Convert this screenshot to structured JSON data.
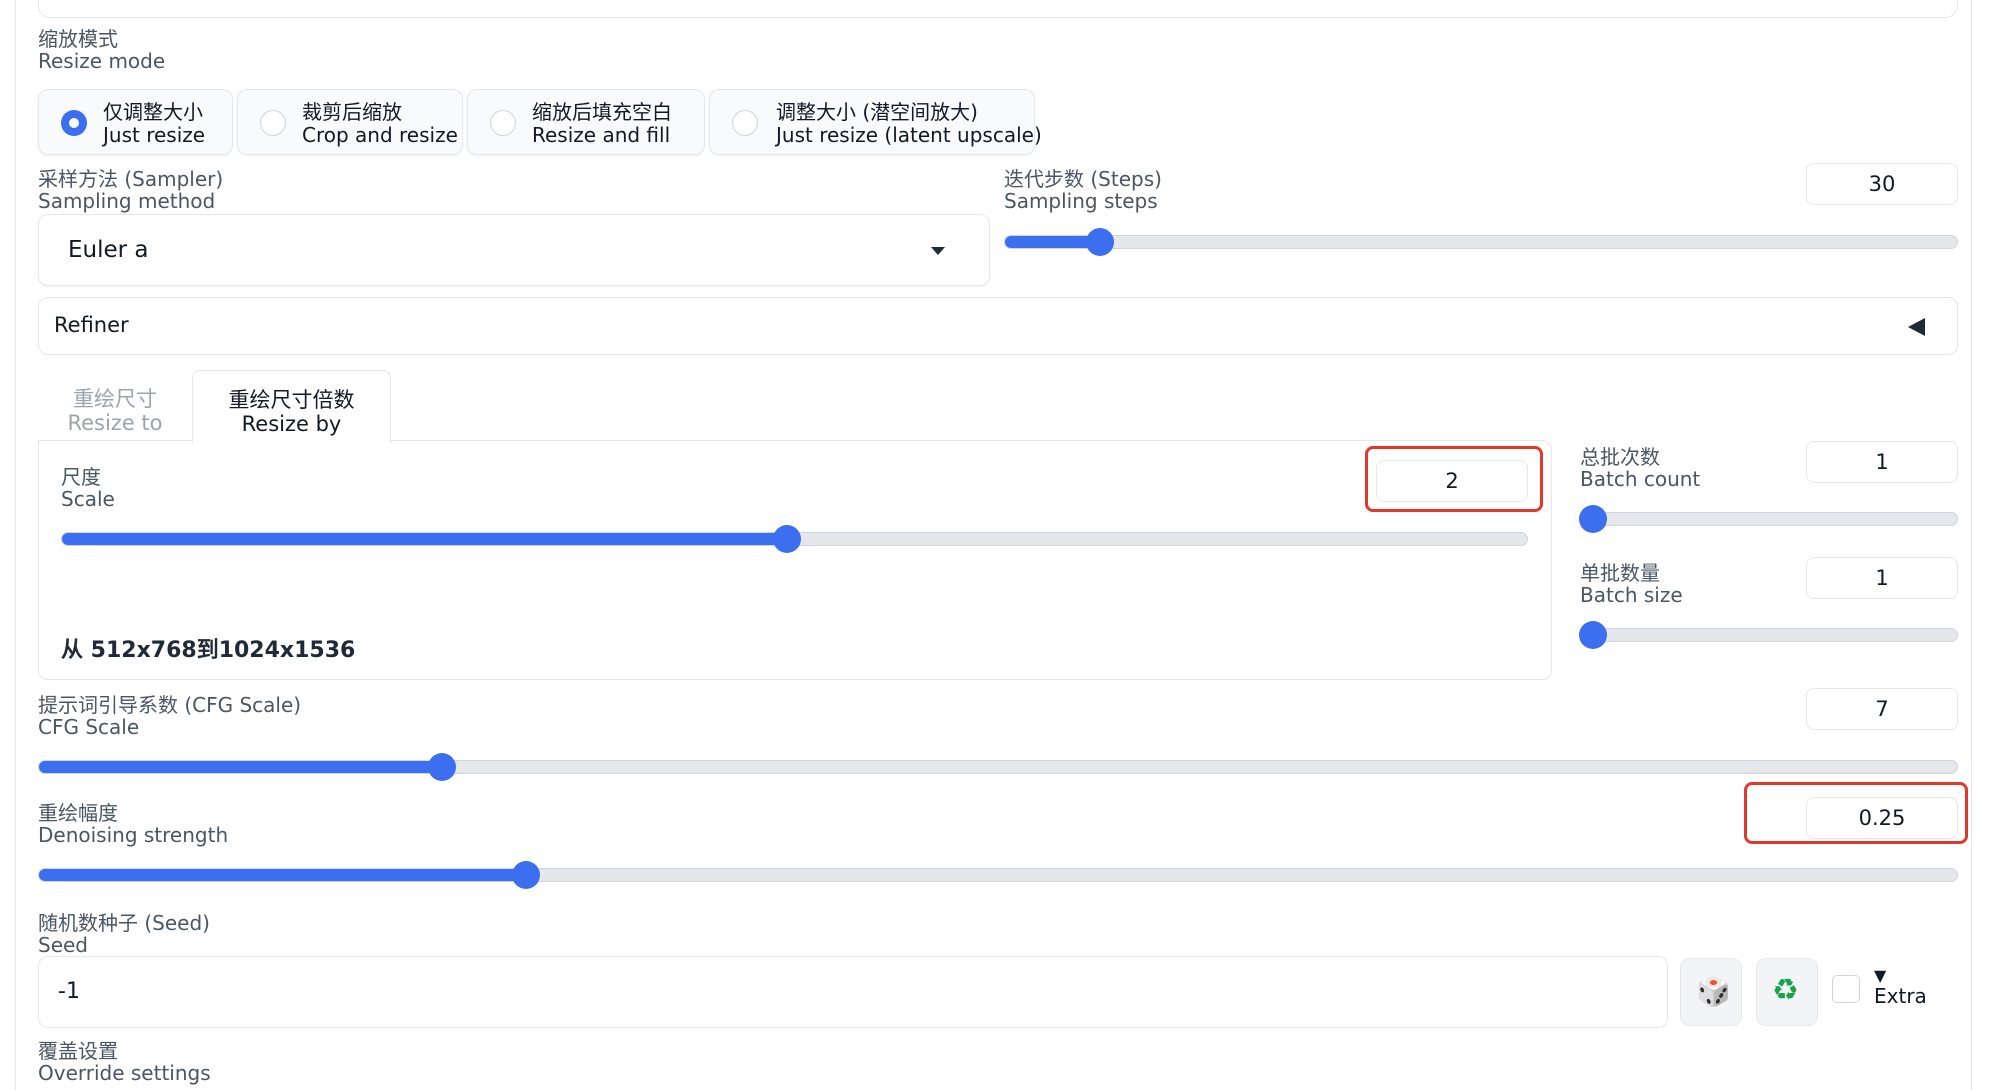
{
  "resize_mode": {
    "label_cn": "缩放模式",
    "label_en": "Resize mode",
    "options": [
      {
        "cn": "仅调整大小",
        "en": "Just resize",
        "selected": true
      },
      {
        "cn": "裁剪后缩放",
        "en": "Crop and resize",
        "selected": false
      },
      {
        "cn": "缩放后填充空白",
        "en": "Resize and fill",
        "selected": false
      },
      {
        "cn": "调整大小 (潜空间放大)",
        "en": "Just resize (latent upscale)",
        "selected": false
      }
    ]
  },
  "sampler": {
    "label_cn": "采样方法 (Sampler)",
    "label_en": "Sampling method",
    "value": "Euler a"
  },
  "steps": {
    "label_cn": "迭代步数 (Steps)",
    "label_en": "Sampling steps",
    "value": "30",
    "fraction": 0.1
  },
  "refiner": {
    "label": "Refiner"
  },
  "tabs": [
    {
      "cn": "重绘尺寸",
      "en": "Resize to",
      "active": false
    },
    {
      "cn": "重绘尺寸倍数",
      "en": "Resize by",
      "active": true
    }
  ],
  "scale": {
    "label_cn": "尺度",
    "label_en": "Scale",
    "value": "2",
    "fraction": 0.495,
    "info": "从 512x768到1024x1536"
  },
  "batch_count": {
    "label_cn": "总批次数",
    "label_en": "Batch count",
    "value": "1",
    "fraction": 0.0
  },
  "batch_size": {
    "label_cn": "单批数量",
    "label_en": "Batch size",
    "value": "1",
    "fraction": 0.0
  },
  "cfg": {
    "label_cn": "提示词引导系数 (CFG Scale)",
    "label_en": "CFG Scale",
    "value": "7",
    "fraction": 0.21
  },
  "denoise": {
    "label_cn": "重绘幅度",
    "label_en": "Denoising strength",
    "value": "0.25",
    "fraction": 0.254
  },
  "seed": {
    "label_cn": "随机数种子 (Seed)",
    "label_en": "Seed",
    "value": "-1",
    "dice_icon": "🎲",
    "recycle_icon": "♻",
    "extra_arrow": "▼",
    "extra_label": "Extra"
  },
  "override": {
    "label_cn": "覆盖设置",
    "label_en": "Override settings"
  },
  "colors": {
    "accent": "#3b6ff0",
    "highlight": "#e0392b"
  }
}
